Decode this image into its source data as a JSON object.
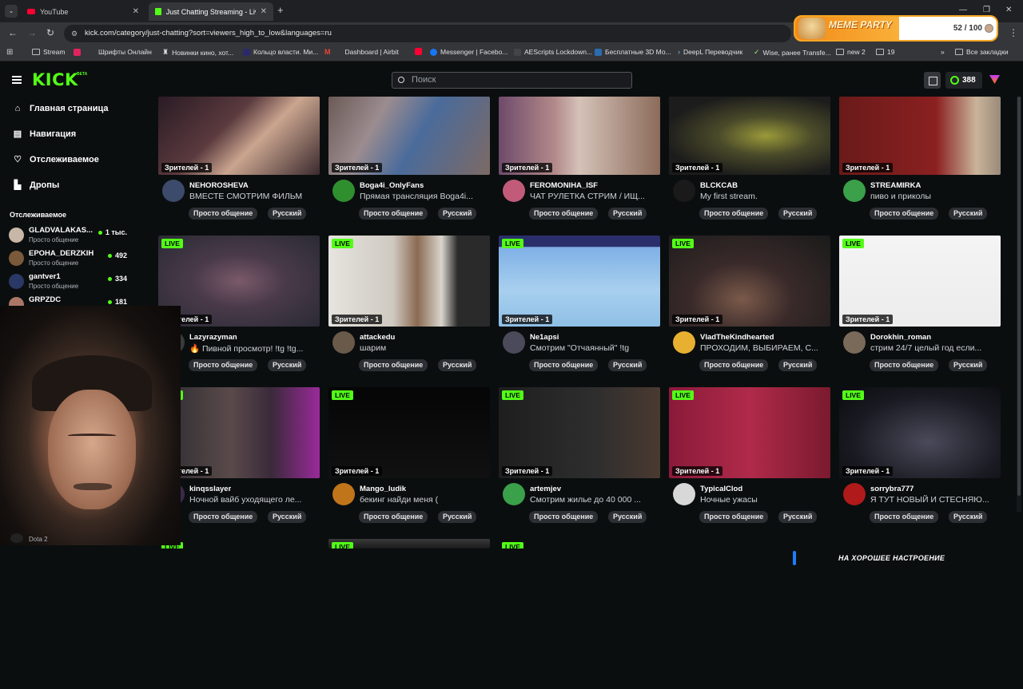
{
  "browser": {
    "tabs": [
      {
        "label": "YouTube"
      },
      {
        "label": "Just Chatting Streaming - Live S"
      }
    ],
    "url": "kick.com/category/just-chatting?sort=viewers_high_to_low&languages=ru",
    "bookmarks": [
      "Stream",
      "Шрифты Онлайн",
      "Новинки кино, хот...",
      "Кольцо власти. Ми...",
      "Dashboard | Airbit",
      "Messenger | Facebo...",
      "AEScripts Lockdown...",
      "Бесплатные 3D Мо...",
      "DeepL Переводчик",
      "Wise, ранее Transfe...",
      "new 2",
      "19",
      "Все закладки"
    ]
  },
  "meme_party": {
    "title": "MEME PARTY",
    "count": "52 / 100"
  },
  "header": {
    "search_placeholder": "Поиск",
    "points": "388",
    "logo": "KICK",
    "beta": "BETA"
  },
  "sidebar": {
    "nav": [
      {
        "label": "Главная страница",
        "icon": "home-icon"
      },
      {
        "label": "Навигация",
        "icon": "compass-icon"
      },
      {
        "label": "Отслеживаемое",
        "icon": "heart-icon"
      },
      {
        "label": "Дропы",
        "icon": "gift-icon"
      }
    ],
    "following_title": "Отслеживаемое",
    "following": [
      {
        "name": "GLADVALAKAS...",
        "category": "Просто общение",
        "viewers": "1 тыс.",
        "color": "#c8b7a6"
      },
      {
        "name": "EPOHA_DERZKIH",
        "category": "Просто общение",
        "viewers": "492",
        "color": "#7a5a3a"
      },
      {
        "name": "gantver1",
        "category": "Просто общение",
        "viewers": "334",
        "color": "#2a3866"
      },
      {
        "name": "GRPZDC",
        "category": "",
        "viewers": "181",
        "color": "#aa7766"
      }
    ],
    "dota_label": "Dota 2"
  },
  "streams": [
    {
      "name": "NEHOROSHEVA",
      "title": "ВМЕСТЕ СМОТРИМ ФИЛЬМ",
      "viewers": "Зрителей - 1",
      "live": false,
      "thumb": "linear-gradient(135deg,#2a1b24 0%,#5a3a3e 40%,#caa58f 60%,#3b2a2e 100%)",
      "avatar": "#3c4a6b"
    },
    {
      "name": "Boga4i_OnlyFans",
      "title": "Прямая трансляция Boga4i...",
      "viewers": "Зрителей - 1",
      "live": false,
      "thumb": "linear-gradient(120deg,#6b5a56 0%,#9b8c8f 30%,#4a6b9b 55%,#7d6a64 100%)",
      "avatar": "#2f8f2f"
    },
    {
      "name": "FEROMONIHA_ISF",
      "title": "ЧАТ РУЛЕТКА СТРИМ / ИЩ...",
      "viewers": "Зрителей - 1",
      "live": false,
      "thumb": "linear-gradient(90deg,#6e4a6a 0%,#b38a8a 35%,#d4c2b8 50%,#8c6b5a 100%)",
      "avatar": "#c25a7a"
    },
    {
      "name": "BLCKCAB",
      "title": "My first stream.",
      "viewers": "Зрителей - 1",
      "live": false,
      "thumb": "radial-gradient(ellipse at 60% 50%,#9a9a3a 0%,#4a4a2a 35%,#1c1c1c 75%)",
      "avatar": "#1a1a1a"
    },
    {
      "name": "STREAMIRKA",
      "title": "пиво и приколы",
      "viewers": "Зрителей - 1",
      "live": false,
      "thumb": "linear-gradient(90deg,#6a1a1a 0%,#8a2020 60%,#c9b49a 85%,#9a8a7a 100%)",
      "avatar": "#3aa04a"
    },
    {
      "name": "Lazyrazyman",
      "title": "🔥 Пивной просмотр! !tg !tg...",
      "viewers": "Зрителей - 1",
      "live": true,
      "thumb": "radial-gradient(ellipse at 50% 50%,#7a5a6a 0%,#4a3a4a 40%,#2a2a34 100%)",
      "avatar": "#3a3a3a"
    },
    {
      "name": "attackedu",
      "title": "шарим",
      "viewers": "Зрителей - 1",
      "live": true,
      "thumb": "linear-gradient(90deg,#e6e4df 0%,#cfc9c0 40%,#8a6a52 55%,#d9d5cd 70%,#2a2a2a 80%)",
      "avatar": "#6a5a4a"
    },
    {
      "name": "Ne1apsi",
      "title": "Смотрим \"Отчаянный\" !tg",
      "viewers": "Зрителей - 1",
      "live": true,
      "thumb": "linear-gradient(180deg,#2a2f6b 0%,#2a2f6b 12%,#7fb0e6 13%,#a8cfee 60%,#8fbfe6 100%)",
      "avatar": "#4a4a5a"
    },
    {
      "name": "VladTheKindhearted",
      "title": "ПРОХОДИМ, ВЫБИРАЕМ, С...",
      "viewers": "Зрителей - 1",
      "live": true,
      "thumb": "radial-gradient(ellipse at 45% 70%,#7a5a4a 0%,#3a2a2a 40%,#1a1a1a 100%)",
      "avatar": "#e8b030"
    },
    {
      "name": "Dorokhin_roman",
      "title": "стрим 24/7 целый год если...",
      "viewers": "Зрителей - 1",
      "live": true,
      "thumb": "linear-gradient(180deg,#f4f4f4 0%,#ececec 100%)",
      "avatar": "#7a6a5a"
    },
    {
      "name": "kinqsslayer",
      "title": "Ночной вайб уходящего ле...",
      "viewers": "Зрителей - 1",
      "live": true,
      "thumb": "linear-gradient(90deg,#2a2a30 0%,#5a4a4a 45%,#3a2a3a 70%,#9a2a9a 100%)",
      "avatar": "#3a2a4a"
    },
    {
      "name": "Mango_ludik",
      "title": "бекинг найди меня (",
      "viewers": "Зрителей - 1",
      "live": true,
      "thumb": "linear-gradient(180deg,#050505 0%,#111 100%)",
      "avatar": "#c0751a"
    },
    {
      "name": "artemjev",
      "title": "Смотрим жилье до 40 000 ...",
      "viewers": "Зрителей - 1",
      "live": true,
      "thumb": "linear-gradient(90deg,#1e1e1e 0%,#2e2e2e 60%,#4a3a30 100%)",
      "avatar": "#3aa04a"
    },
    {
      "name": "TypicalClod",
      "title": "Ночные ужасы",
      "viewers": "Зрителей - 1",
      "live": true,
      "thumb": "linear-gradient(90deg,#8a1a3a 0%,#b02a4a 50%,#7a1a2e 100%)",
      "avatar": "#d8d8d8"
    },
    {
      "name": "sorrybra777",
      "title": "Я ТУТ НОВЫЙ И СТЕСНЯЮ...",
      "viewers": "Зрителей - 1",
      "live": true,
      "thumb": "radial-gradient(ellipse at 55% 60%,#4a4a5a 0%,#1a1a22 60%,#0a0a10 100%)",
      "avatar": "#b01a1a"
    },
    {
      "name": "",
      "title": "",
      "viewers": "",
      "live": true,
      "thumb": "linear-gradient(180deg,#0b0e0f,#0b0e0f)",
      "avatar": "#0b0e0f"
    },
    {
      "name": "",
      "title": "",
      "viewers": "",
      "live": true,
      "thumb": "linear-gradient(180deg,#3a3a3a,#1a1a1a)",
      "avatar": "#0b0e0f"
    },
    {
      "name": "",
      "title": "",
      "viewers": "",
      "live": true,
      "thumb": "linear-gradient(180deg,#0b0e0f,#0b0e0f)",
      "avatar": "#0b0e0f"
    }
  ],
  "tags": [
    "Просто общение",
    "Русский"
  ],
  "overlay_caption": "НА ХОРОШЕЕ НАСТРОЕНИЕ",
  "colors": {
    "accent": "#53fc18",
    "background": "#0b0e0f",
    "tag": "#2c2f33"
  }
}
